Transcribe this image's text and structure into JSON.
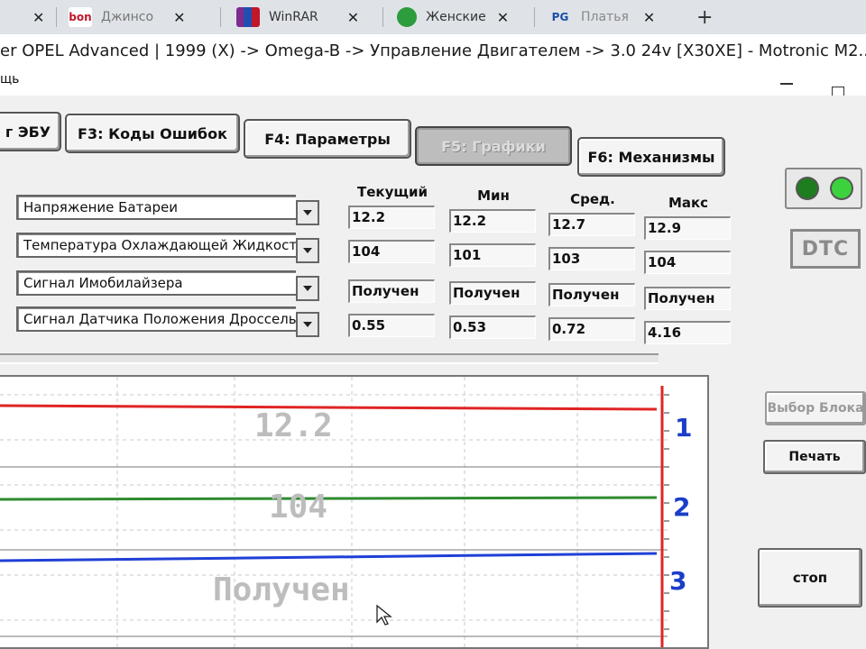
{
  "browser_tabs": [
    {
      "title": "Джинсо",
      "icon": "bonprix-icon",
      "icon_text": "bon",
      "color": "#c0182a"
    },
    {
      "title": "WinRAR",
      "icon": "winrar-icon",
      "icon_text": "",
      "color": "#7a2c8f"
    },
    {
      "title": "Женские",
      "icon": "frog-icon",
      "icon_text": "",
      "color": "#2c9c3c"
    },
    {
      "title": "Платья",
      "icon": "ali-icon",
      "icon_text": "PG",
      "color": "#1a4ea8"
    }
  ],
  "window": {
    "title": "er OPEL Advanced | 1999 (X) -> Omega-B -> Управление Двигателем -> 3.0 24v [X30XE] - Motronic M2....",
    "menu_item": "щь"
  },
  "function_buttons": [
    {
      "label": "г ЭБУ"
    },
    {
      "label": "F3:  Коды Ошибок"
    },
    {
      "label": "F4:  Параметры"
    },
    {
      "label": "F5:  Графики",
      "active": true
    },
    {
      "label": "F6:  Механизмы"
    }
  ],
  "columns": [
    "Текущий",
    "Мин",
    "Сред.",
    "Макс"
  ],
  "parameters": [
    {
      "name": "Напряжение Батареи",
      "current": "12.2",
      "min": "12.2",
      "avg": "12.7",
      "max": "12.9"
    },
    {
      "name": "Температура Охлаждающей Жидкост",
      "current": "104",
      "min": "101",
      "avg": "103",
      "max": "104"
    },
    {
      "name": "Сигнал Имобилайзера",
      "current": "Получен",
      "min": "Получен",
      "avg": "Получен",
      "max": "Получен"
    },
    {
      "name": "Сигнал Датчика Положения Дроссель",
      "current": "0.55",
      "min": "0.53",
      "avg": "0.72",
      "max": "4.16"
    }
  ],
  "status": {
    "dtc_label": "DTC",
    "led_colors": [
      "#1e7d1e",
      "#3ed13e"
    ]
  },
  "side_buttons": {
    "block_select": "Выбор Блока",
    "print": "Печать",
    "stop": "стоп"
  },
  "graph": {
    "traces": [
      {
        "channel": "1",
        "readout": "12.2",
        "color": "#e02424"
      },
      {
        "channel": "2",
        "readout": "104",
        "color": "#2e8b2e"
      },
      {
        "channel": "3",
        "readout": "Получен",
        "color": "#1f3fd6"
      }
    ]
  }
}
